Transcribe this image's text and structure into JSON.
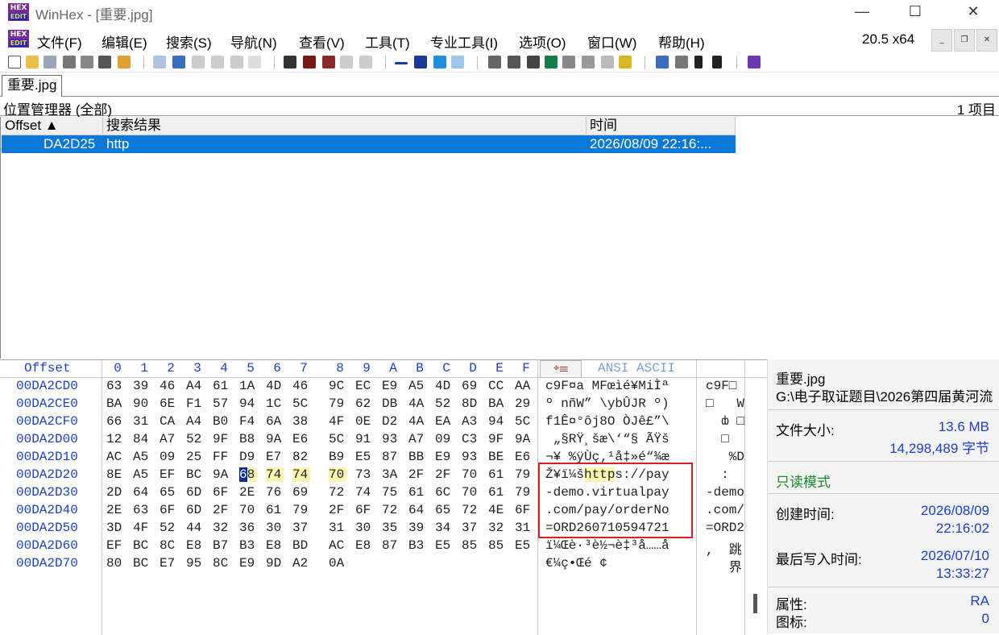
{
  "window": {
    "title": "WinHex - [重要.jpg]",
    "app_logo_top": "HEX",
    "app_logo_bottom": "EDIT",
    "minimize": "—",
    "maximize": "☐",
    "close": "✕"
  },
  "menu": {
    "items": [
      "文件(F)",
      "编辑(E)",
      "搜索(S)",
      "导航(N)",
      "查看(V)",
      "工具(T)",
      "专业工具(I)",
      "选项(O)",
      "窗口(W)",
      "帮助(H)"
    ],
    "version": "20.5 x64",
    "mdi_minimize": "_",
    "mdi_restore": "❐",
    "mdi_close": "✕"
  },
  "tab": {
    "label": "重要.jpg"
  },
  "position_bar": {
    "title": "位置管理器 (全部)",
    "count": "1 项目"
  },
  "list": {
    "headers": {
      "offset": "Offset ▲",
      "result": "搜索结果",
      "time": "时间"
    },
    "row": {
      "offset": "DA2D25",
      "result": "http",
      "time": "2026/08/09  22:16:..."
    }
  },
  "hex": {
    "header_offset": "Offset",
    "header_cols": [
      "0",
      "1",
      "2",
      "3",
      "4",
      "5",
      "6",
      "7",
      "8",
      "9",
      "A",
      "B",
      "C",
      "D",
      "E",
      "F"
    ],
    "header_ansi": "ANSI ASCII",
    "rows": [
      {
        "off": "00DA2CD0",
        "bytes": [
          "63",
          "39",
          "46",
          "A4",
          "61",
          "1A",
          "4D",
          "46",
          "9C",
          "EC",
          "E9",
          "A5",
          "4D",
          "69",
          "CC",
          "AA"
        ],
        "ansi": "c9F¤a MFœìé¥MiÌª",
        "ansi2": "c9F□"
      },
      {
        "off": "00DA2CE0",
        "bytes": [
          "BA",
          "90",
          "6E",
          "F1",
          "57",
          "94",
          "1C",
          "5C",
          "79",
          "62",
          "DB",
          "4A",
          "52",
          "8D",
          "BA",
          "29"
        ],
        "ansi": "º nñW” \\ybÛJR º)",
        "ansi2": "□   W"
      },
      {
        "off": "00DA2CF0",
        "bytes": [
          "66",
          "31",
          "CA",
          "A4",
          "B0",
          "F4",
          "6A",
          "38",
          "4F",
          "0E",
          "D2",
          "4A",
          "EA",
          "A3",
          "94",
          "5C"
        ],
        "ansi": "f1Ê¤°ôj8O ÒJê£”\\",
        "ansi2": "  ȸ □"
      },
      {
        "off": "00DA2D00",
        "bytes": [
          "12",
          "84",
          "A7",
          "52",
          "9F",
          "B8",
          "9A",
          "E6",
          "5C",
          "91",
          "93",
          "A7",
          "09",
          "C3",
          "9F",
          "9A"
        ],
        "ansi": " „§RŸ¸šæ\\‘“§ ÃŸš",
        "ansi2": "  □"
      },
      {
        "off": "00DA2D10",
        "bytes": [
          "AC",
          "A5",
          "09",
          "25",
          "FF",
          "D9",
          "E7",
          "82",
          "B9",
          "E5",
          "87",
          "BB",
          "E9",
          "93",
          "BE",
          "E6"
        ],
        "ansi": "¬¥ %ÿÙç‚¹å‡»é“¾æ",
        "ansi2": "   %D"
      },
      {
        "off": "00DA2D20",
        "bytes": [
          "8E",
          "A5",
          "EF",
          "BC",
          "9A",
          "68",
          "74",
          "74",
          "70",
          "73",
          "3A",
          "2F",
          "2F",
          "70",
          "61",
          "79"
        ],
        "ansi": "Ž¥ï¼šhttps://pay",
        "ansi2": "  :"
      },
      {
        "off": "00DA2D30",
        "bytes": [
          "2D",
          "64",
          "65",
          "6D",
          "6F",
          "2E",
          "76",
          "69",
          "72",
          "74",
          "75",
          "61",
          "6C",
          "70",
          "61",
          "79"
        ],
        "ansi": "-demo.virtualpay",
        "ansi2": "-demo"
      },
      {
        "off": "00DA2D40",
        "bytes": [
          "2E",
          "63",
          "6F",
          "6D",
          "2F",
          "70",
          "61",
          "79",
          "2F",
          "6F",
          "72",
          "64",
          "65",
          "72",
          "4E",
          "6F"
        ],
        "ansi": ".com/pay/orderNo",
        "ansi2": ".com/"
      },
      {
        "off": "00DA2D50",
        "bytes": [
          "3D",
          "4F",
          "52",
          "44",
          "32",
          "36",
          "30",
          "37",
          "31",
          "30",
          "35",
          "39",
          "34",
          "37",
          "32",
          "31"
        ],
        "ansi": "=ORD260710594721",
        "ansi2": "=ORD2"
      },
      {
        "off": "00DA2D60",
        "bytes": [
          "EF",
          "BC",
          "8C",
          "E8",
          "B7",
          "B3",
          "E8",
          "BD",
          "AC",
          "E8",
          "87",
          "B3",
          "E5",
          "85",
          "85",
          "E5"
        ],
        "ansi": "ï¼Œè·³è½¬è‡³å……å",
        "ansi2": ",  跳"
      },
      {
        "off": "00DA2D70",
        "bytes": [
          "80",
          "BC",
          "E7",
          "95",
          "8C",
          "E9",
          "9D",
          "A2",
          "0A"
        ],
        "ansi": "€¼ç•Œé ¢",
        "ansi2": "   界"
      }
    ]
  },
  "info": {
    "filename": "重要.jpg",
    "path": "G:\\电子取证题目\\2026第四届黄河流",
    "size_label": "文件大小:",
    "size_mb": "13.6 MB",
    "size_bytes": "14,298,489 字节",
    "mode": "只读模式",
    "created_label": "创建时间:",
    "created_date": "2026/08/09",
    "created_time": "22:16:02",
    "modified_label": "最后写入时间:",
    "modified_date": "2026/07/10",
    "modified_time": "13:33:27",
    "attr_label": "属性:",
    "attr_value": "RA",
    "icon_label": "图标:",
    "icon_value": "0"
  }
}
